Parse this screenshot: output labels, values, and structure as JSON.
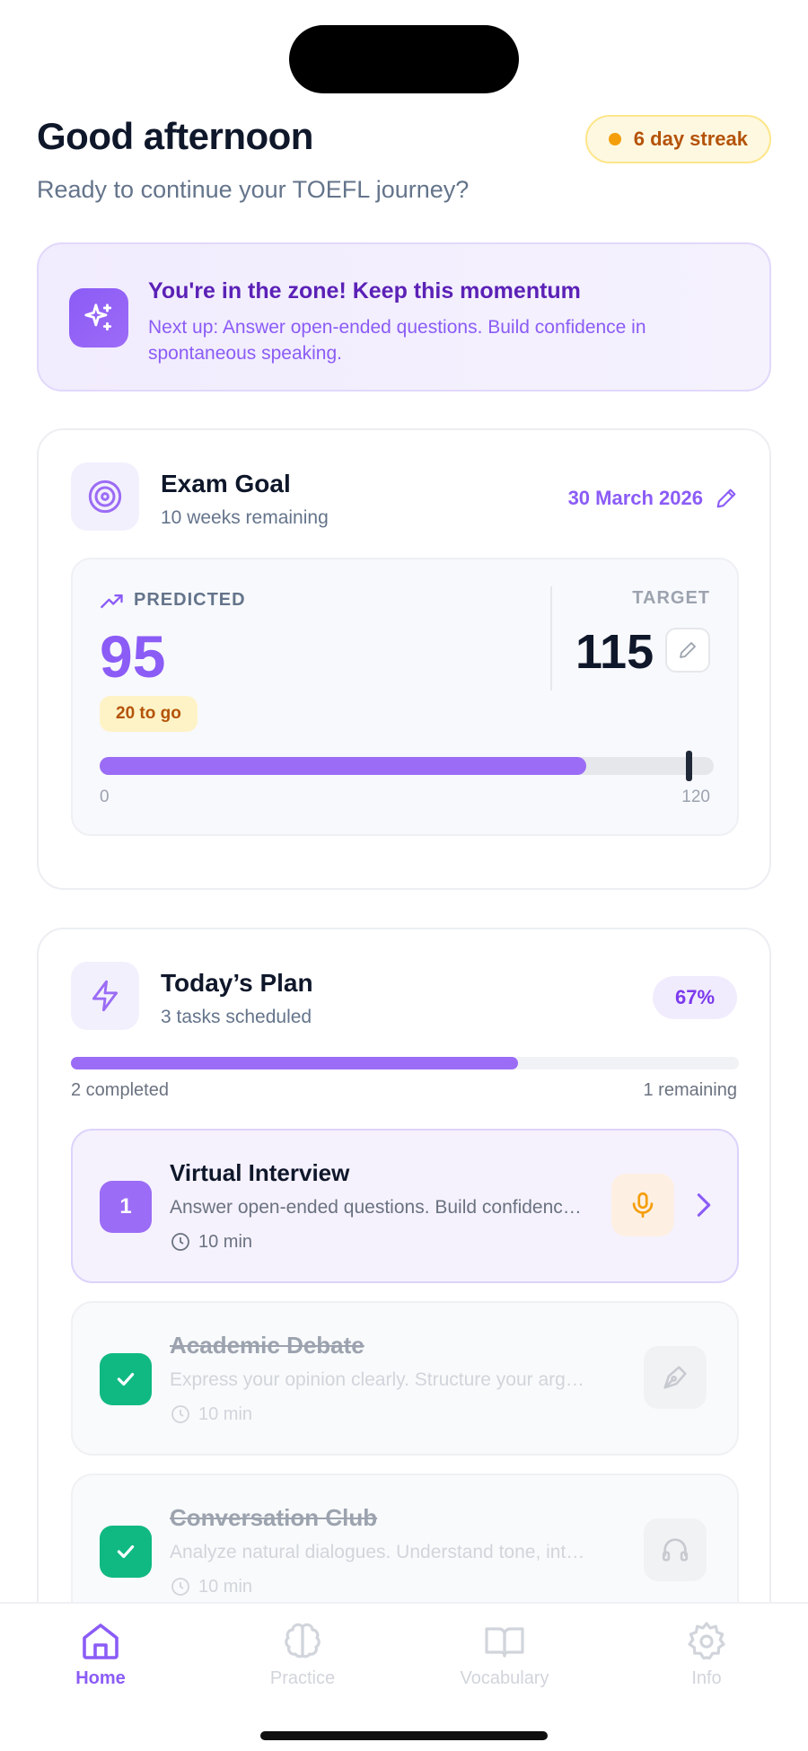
{
  "header": {
    "greeting": "Good afternoon",
    "subtitle": "Ready to continue your TOEFL journey?",
    "streak": "6 day streak"
  },
  "banner": {
    "title": "You're in the zone! Keep this momentum",
    "description": "Next up: Answer open-ended questions. Build confidence in spontaneous speaking.",
    "icon": "sparkles-icon"
  },
  "goal": {
    "title": "Exam Goal",
    "subtitle": "10 weeks remaining",
    "date": "30 March 2026",
    "predicted_label": "PREDICTED",
    "predicted": "95",
    "to_go": "20 to go",
    "target_label": "TARGET",
    "target": "115",
    "scale_min": "0",
    "scale_max": "120",
    "predicted_value": 95,
    "target_value": 115,
    "scale_min_value": 0,
    "scale_max_value": 120
  },
  "plan": {
    "title": "Today’s Plan",
    "subtitle": "3 tasks scheduled",
    "percent": "67%",
    "progress_fraction": 0.67,
    "completed": "2 completed",
    "remaining": "1 remaining",
    "tasks": [
      {
        "title": "Virtual Interview",
        "description": "Answer open-ended questions. Build confidence in spontaneous speaking.",
        "duration": "10 min",
        "number": "1",
        "status": "active",
        "icon": "microphone-icon"
      },
      {
        "title": "Academic Debate",
        "description": "Express your opinion clearly. Structure your arguments.",
        "duration": "10 min",
        "status": "done",
        "icon": "pen-nib-icon"
      },
      {
        "title": "Conversation Club",
        "description": "Analyze natural dialogues. Understand tone, intent and context.",
        "duration": "10 min",
        "status": "done",
        "icon": "headphones-icon"
      }
    ]
  },
  "tabs": [
    {
      "label": "Home",
      "icon": "home-icon",
      "active": true
    },
    {
      "label": "Practice",
      "icon": "brain-icon",
      "active": false
    },
    {
      "label": "Vocabulary",
      "icon": "book-icon",
      "active": false
    },
    {
      "label": "Info",
      "icon": "gear-icon",
      "active": false
    }
  ],
  "colors": {
    "accent": "#8b5cf6",
    "success": "#10b981",
    "warning": "#f59e0b"
  }
}
